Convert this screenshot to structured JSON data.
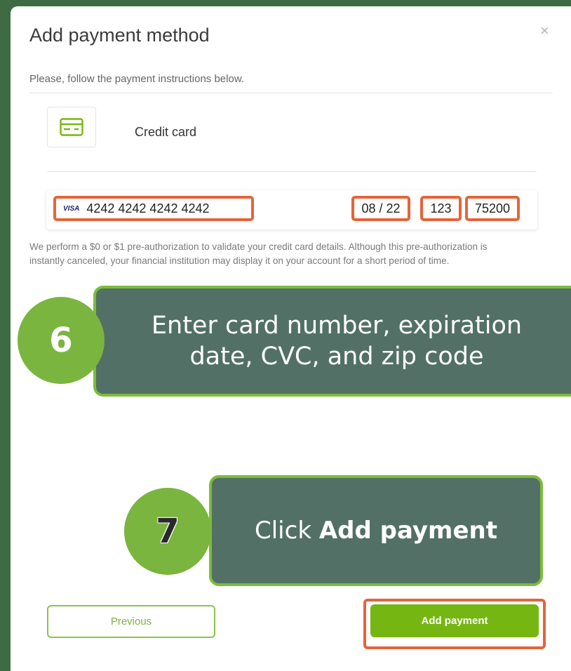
{
  "dialog": {
    "title": "Add payment method",
    "close_label": "×",
    "subtitle": "Please, follow the payment instructions below."
  },
  "payment_method": {
    "label": "Credit card",
    "icon": "credit-card-icon"
  },
  "card_form": {
    "brand": "VISA",
    "card_number": "4242 4242 4242 4242",
    "expiry": "08 / 22",
    "cvc": "123",
    "zip": "75200"
  },
  "notice": "We perform a $0 or $1 pre-authorization to validate your credit card details. Although this pre-authorization is instantly canceled, your financial institution may display it on your account for a short period of time.",
  "callouts": {
    "step6": {
      "number": "6",
      "line1": "Enter card number, expiration",
      "line2": "date, CVC, and zip code"
    },
    "step7": {
      "number": "7",
      "text_prefix": "Click ",
      "text_bold": "Add payment"
    }
  },
  "buttons": {
    "previous": "Previous",
    "add_payment": "Add payment"
  },
  "colors": {
    "accent_green": "#76b612",
    "highlight_orange": "#e5643a",
    "callout_fill": "#527066"
  }
}
